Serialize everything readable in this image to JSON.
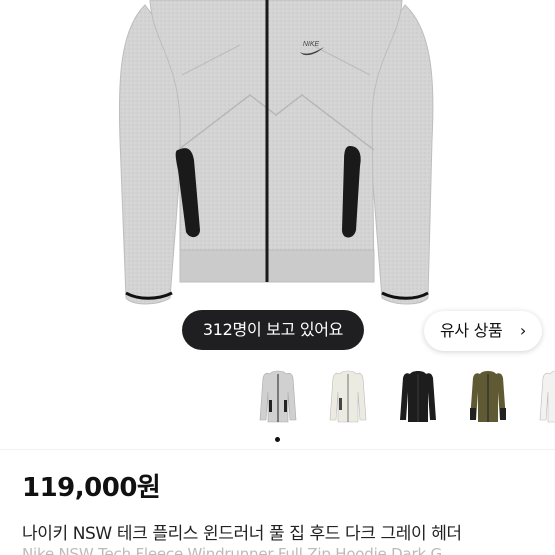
{
  "product": {
    "viewers_text": "312명이 보고 있어요",
    "similar_label": "유사 상품",
    "similar_chevron": "›",
    "price": "119,000원",
    "title": "나이키 NSW 테크 플리스 윈드러너 풀 집 후드 다크 그레이 헤더",
    "subtitle": "Nike NSW Tech Fleece Windrunner Full Zip Hoodie Dark G",
    "brand_mark": "NIKE"
  },
  "thumbnails": {
    "items": [
      "grey-hoodie",
      "cream-hoodie",
      "black-hoodie",
      "olive-hoodie",
      "white-hoodie"
    ],
    "active_index": 0
  },
  "colors": {
    "pill_bg": "#1f1f21",
    "hoodie_grey": "#cfcfcf",
    "zipper": "#1a1a1a"
  }
}
